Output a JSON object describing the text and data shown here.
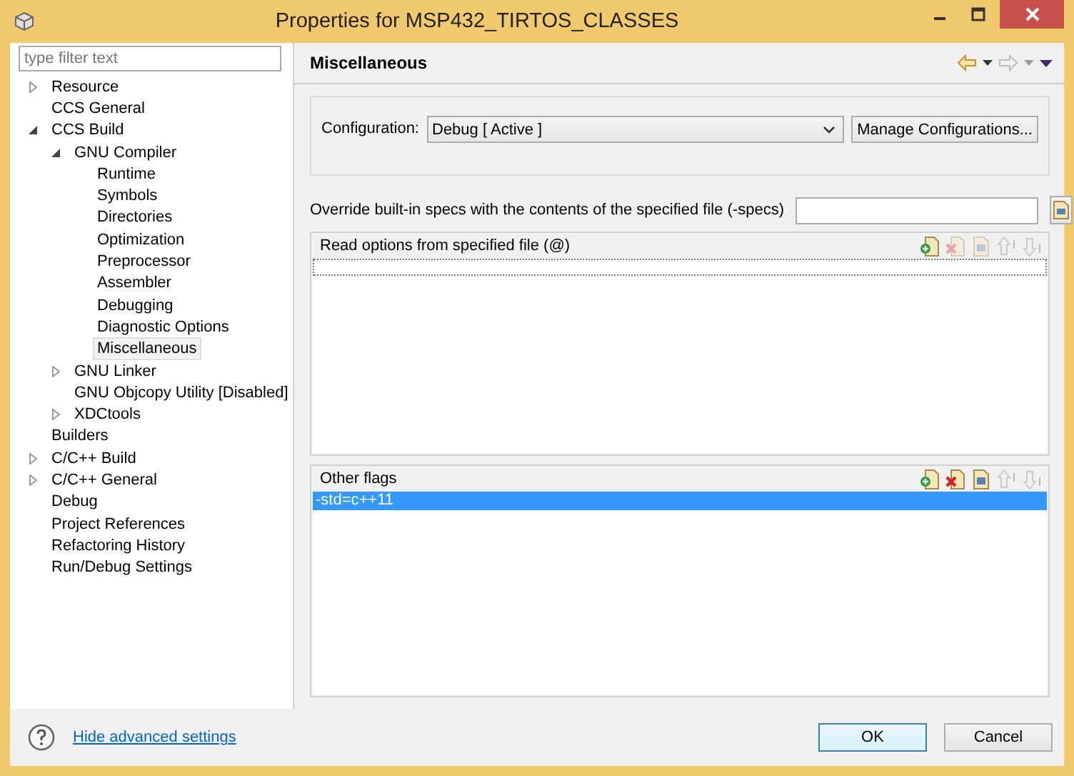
{
  "window": {
    "title": "Properties for MSP432_TIRTOS_CLASSES"
  },
  "filter": {
    "placeholder": "type filter text"
  },
  "tree": [
    {
      "label": "Resource",
      "expanded": false,
      "selected": false
    },
    {
      "label": "CCS General",
      "selected": false
    },
    {
      "label": "CCS Build",
      "expanded": true,
      "selected": false,
      "children": [
        {
          "label": "GNU Compiler",
          "expanded": true,
          "selected": false,
          "children": [
            {
              "label": "Runtime",
              "selected": false
            },
            {
              "label": "Symbols",
              "selected": false
            },
            {
              "label": "Directories",
              "selected": false
            },
            {
              "label": "Optimization",
              "selected": false
            },
            {
              "label": "Preprocessor",
              "selected": false
            },
            {
              "label": "Assembler",
              "selected": false
            },
            {
              "label": "Debugging",
              "selected": false
            },
            {
              "label": "Diagnostic Options",
              "selected": false
            },
            {
              "label": "Miscellaneous",
              "selected": true
            }
          ]
        },
        {
          "label": "GNU Linker",
          "expanded": false,
          "selected": false
        },
        {
          "label": "GNU Objcopy Utility  [Disabled]",
          "selected": false
        },
        {
          "label": "XDCtools",
          "expanded": false,
          "selected": false
        }
      ]
    },
    {
      "label": "Builders",
      "selected": false
    },
    {
      "label": "C/C++ Build",
      "expanded": false,
      "selected": false
    },
    {
      "label": "C/C++ General",
      "expanded": false,
      "selected": false
    },
    {
      "label": "Debug",
      "selected": false
    },
    {
      "label": "Project References",
      "selected": false
    },
    {
      "label": "Refactoring History",
      "selected": false
    },
    {
      "label": "Run/Debug Settings",
      "selected": false
    }
  ],
  "page": {
    "title": "Miscellaneous"
  },
  "configuration": {
    "label": "Configuration:",
    "value": "Debug  [ Active ]",
    "manage_button": "Manage Configurations..."
  },
  "specs": {
    "label": "Override built-in specs with the contents of the specified file (-specs)"
  },
  "lists": [
    {
      "title": "Read options from specified file (@)",
      "tools": [
        {
          "kind": "add",
          "disabled": false
        },
        {
          "kind": "delete",
          "disabled": true
        },
        {
          "kind": "edit",
          "disabled": true
        },
        {
          "kind": "up",
          "disabled": true
        },
        {
          "kind": "down",
          "disabled": true
        }
      ],
      "editing": true
    },
    {
      "title": "Other flags",
      "tools": [
        {
          "kind": "add",
          "disabled": false
        },
        {
          "kind": "delete",
          "disabled": false
        },
        {
          "kind": "edit",
          "disabled": false
        },
        {
          "kind": "up",
          "disabled": true
        },
        {
          "kind": "down",
          "disabled": true
        }
      ],
      "items": [
        {
          "text": "-std=c++11",
          "selected": true
        }
      ],
      "editing": false
    }
  ],
  "footer": {
    "link": "Hide advanced settings",
    "buttons": [
      {
        "label": "OK",
        "default": true
      },
      {
        "label": "Cancel",
        "default": false
      }
    ]
  }
}
